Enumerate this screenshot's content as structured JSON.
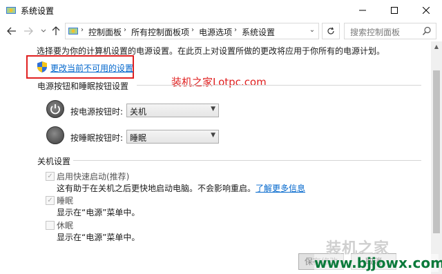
{
  "window": {
    "title": "系统设置"
  },
  "nav": {
    "breadcrumbs": [
      "控制面板",
      "所有控制面板项",
      "电源选项",
      "系统设置"
    ],
    "search_placeholder": "搜索控制面板"
  },
  "content": {
    "intro": "选择要为你的计算机设置的电源设置。在此页上对设置所做的更改将应用于你所有的电源计划。",
    "change_link": "更改当前不可用的设置",
    "watermark": "装机之家Lotpc.com",
    "power_section": {
      "title": "电源按钮和睡眠按钮设置",
      "rows": [
        {
          "label": "按电源按钮时:",
          "value": "关机"
        },
        {
          "label": "按睡眠按钮时:",
          "value": "睡眠"
        }
      ]
    },
    "shutdown_section": {
      "title": "关机设置",
      "items": [
        {
          "label": "启用快速启动(推荐)",
          "checked": true,
          "desc": "这有助于在关机之后更快地启动电脑。不会影响重启。",
          "link": "了解更多信息"
        },
        {
          "label": "睡眠",
          "checked": true,
          "desc": "显示在“电源”菜单中。"
        },
        {
          "label": "休眠",
          "checked": false,
          "desc": "显示在“电源”菜单中。"
        }
      ]
    }
  },
  "footer": {
    "save_label": "保存修改",
    "cancel_label": "取消"
  },
  "branding": {
    "mark": "装机之家",
    "url": "www.bjjowx.com"
  },
  "colors": {
    "highlight_box": "#e02020",
    "link": "#0066cc",
    "watermark_text": "#e02020",
    "brand_url": "#0b7a3b"
  }
}
